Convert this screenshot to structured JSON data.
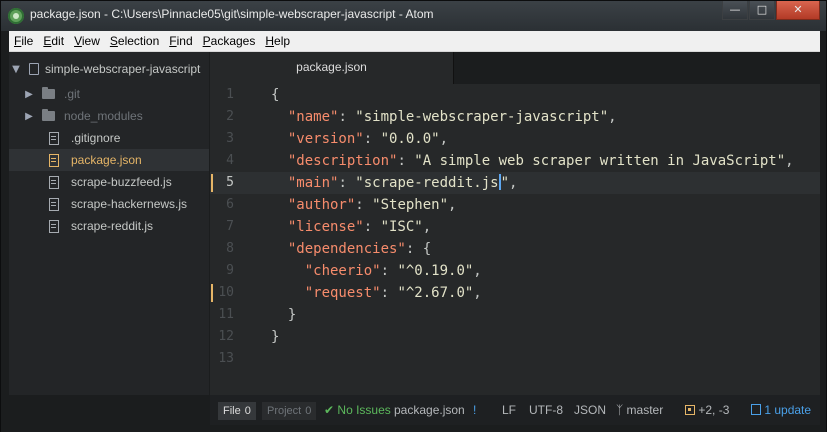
{
  "window": {
    "title": "package.json - C:\\Users\\Pinnacle05\\git\\simple-webscraper-javascript - Atom",
    "minimize_glyph": "—",
    "maximize_glyph": "□",
    "close_glyph": "✕"
  },
  "menu": {
    "items": [
      {
        "key": "F",
        "rest": "ile"
      },
      {
        "key": "E",
        "rest": "dit"
      },
      {
        "key": "V",
        "rest": "iew"
      },
      {
        "key": "S",
        "rest": "election"
      },
      {
        "key": "F",
        "rest": "ind"
      },
      {
        "key": "P",
        "rest": "ackages"
      },
      {
        "key": "H",
        "rest": "elp"
      }
    ]
  },
  "tree": {
    "root": "simple-webscraper-javascript",
    "entries": [
      {
        "label": ".git",
        "type": "dir"
      },
      {
        "label": "node_modules",
        "type": "dir"
      },
      {
        "label": ".gitignore",
        "type": "file"
      },
      {
        "label": "package.json",
        "type": "file",
        "selected": true
      },
      {
        "label": "scrape-buzzfeed.js",
        "type": "file"
      },
      {
        "label": "scrape-hackernews.js",
        "type": "file"
      },
      {
        "label": "scrape-reddit.js",
        "type": "file"
      }
    ]
  },
  "tabs": [
    {
      "label": "package.json",
      "active": true
    }
  ],
  "editor": {
    "lines": [
      {
        "n": "1",
        "modified": false,
        "cursor": false
      },
      {
        "n": "2",
        "modified": false,
        "cursor": false
      },
      {
        "n": "3",
        "modified": false,
        "cursor": false
      },
      {
        "n": "4",
        "modified": false,
        "cursor": false
      },
      {
        "n": "5",
        "modified": true,
        "cursor": true
      },
      {
        "n": "6",
        "modified": false,
        "cursor": false
      },
      {
        "n": "7",
        "modified": false,
        "cursor": false
      },
      {
        "n": "8",
        "modified": false,
        "cursor": false
      },
      {
        "n": "9",
        "modified": false,
        "cursor": false
      },
      {
        "n": "10",
        "modified": true,
        "cursor": false
      },
      {
        "n": "11",
        "modified": false,
        "cursor": false
      },
      {
        "n": "12",
        "modified": false,
        "cursor": false
      },
      {
        "n": "13",
        "modified": false,
        "cursor": false
      }
    ],
    "code": {
      "open_brace": "{",
      "name_key": "\"name\"",
      "name_val": "\"simple-webscraper-javascript\"",
      "version_key": "\"version\"",
      "version_val": "\"0.0.0\"",
      "description_key": "\"description\"",
      "description_val": "\"A simple web scraper written in JavaScript\"",
      "main_key": "\"main\"",
      "main_val": "\"scrape-reddit.js",
      "main_val_end": "\"",
      "author_key": "\"author\"",
      "author_val": "\"Stephen\"",
      "license_key": "\"license\"",
      "license_val": "\"ISC\"",
      "dependencies_key": "\"dependencies\"",
      "cheerio_key": "\"cheerio\"",
      "cheerio_val": "\"^0.19.0\"",
      "request_key": "\"request\"",
      "request_val": "\"^2.67.0\"",
      "inner_close": "}",
      "close_brace": "}"
    }
  },
  "status": {
    "file_label": "File",
    "file_count": "0",
    "project_label": "Project",
    "project_count": "0",
    "issues": "No Issues",
    "filename": "package.json",
    "grammar_marker": "!",
    "line_ending": "LF",
    "encoding": "UTF-8",
    "grammar": "JSON",
    "branch": "master",
    "diff": "+2, -3",
    "updates": "1 update"
  },
  "colors": {
    "keyword": "#f78c6c",
    "string": "#e2e2c8",
    "selected_file": "#e5b567",
    "update": "#4aa0e8",
    "ok": "#5cb85c"
  }
}
